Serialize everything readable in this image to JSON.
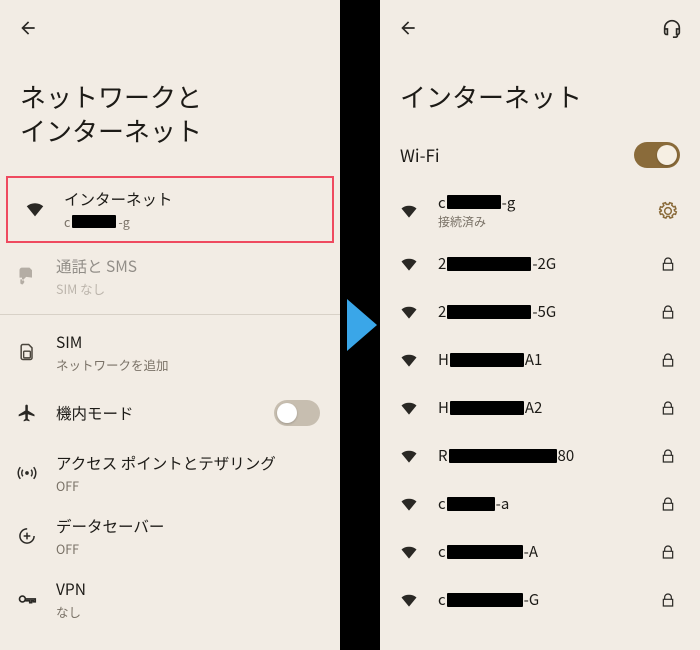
{
  "left": {
    "title_l1": "ネットワークと",
    "title_l2": "インターネット",
    "items": {
      "internet": {
        "label": "インターネット",
        "sub_prefix": "c",
        "sub_suffix": "-g"
      },
      "calls": {
        "label": "通話と SMS",
        "sub": "SIM なし"
      },
      "sim": {
        "label": "SIM",
        "sub": "ネットワークを追加"
      },
      "airplane": {
        "label": "機内モード"
      },
      "hotspot": {
        "label": "アクセス ポイントとテザリング",
        "sub": "OFF"
      },
      "datasaver": {
        "label": "データセーバー",
        "sub": "OFF"
      },
      "vpn": {
        "label": "VPN",
        "sub": "なし"
      }
    }
  },
  "right": {
    "title": "インターネット",
    "wifi_label": "Wi-Fi",
    "connected": {
      "prefix": "c",
      "suffix": "-g",
      "status": "接続済み"
    },
    "networks": [
      {
        "prefix": "2",
        "suffix": "-2G",
        "redact_w": 84
      },
      {
        "prefix": "2",
        "suffix": "-5G",
        "redact_w": 84
      },
      {
        "prefix": "H",
        "suffix": "A1",
        "redact_w": 74
      },
      {
        "prefix": "H",
        "suffix": "A2",
        "redact_w": 74
      },
      {
        "prefix": "R",
        "suffix": "80",
        "redact_w": 108
      },
      {
        "prefix": "c",
        "suffix": "-a",
        "redact_w": 48
      },
      {
        "prefix": "c",
        "suffix": "-A",
        "redact_w": 76
      },
      {
        "prefix": "c",
        "suffix": "-G",
        "redact_w": 76
      }
    ]
  }
}
